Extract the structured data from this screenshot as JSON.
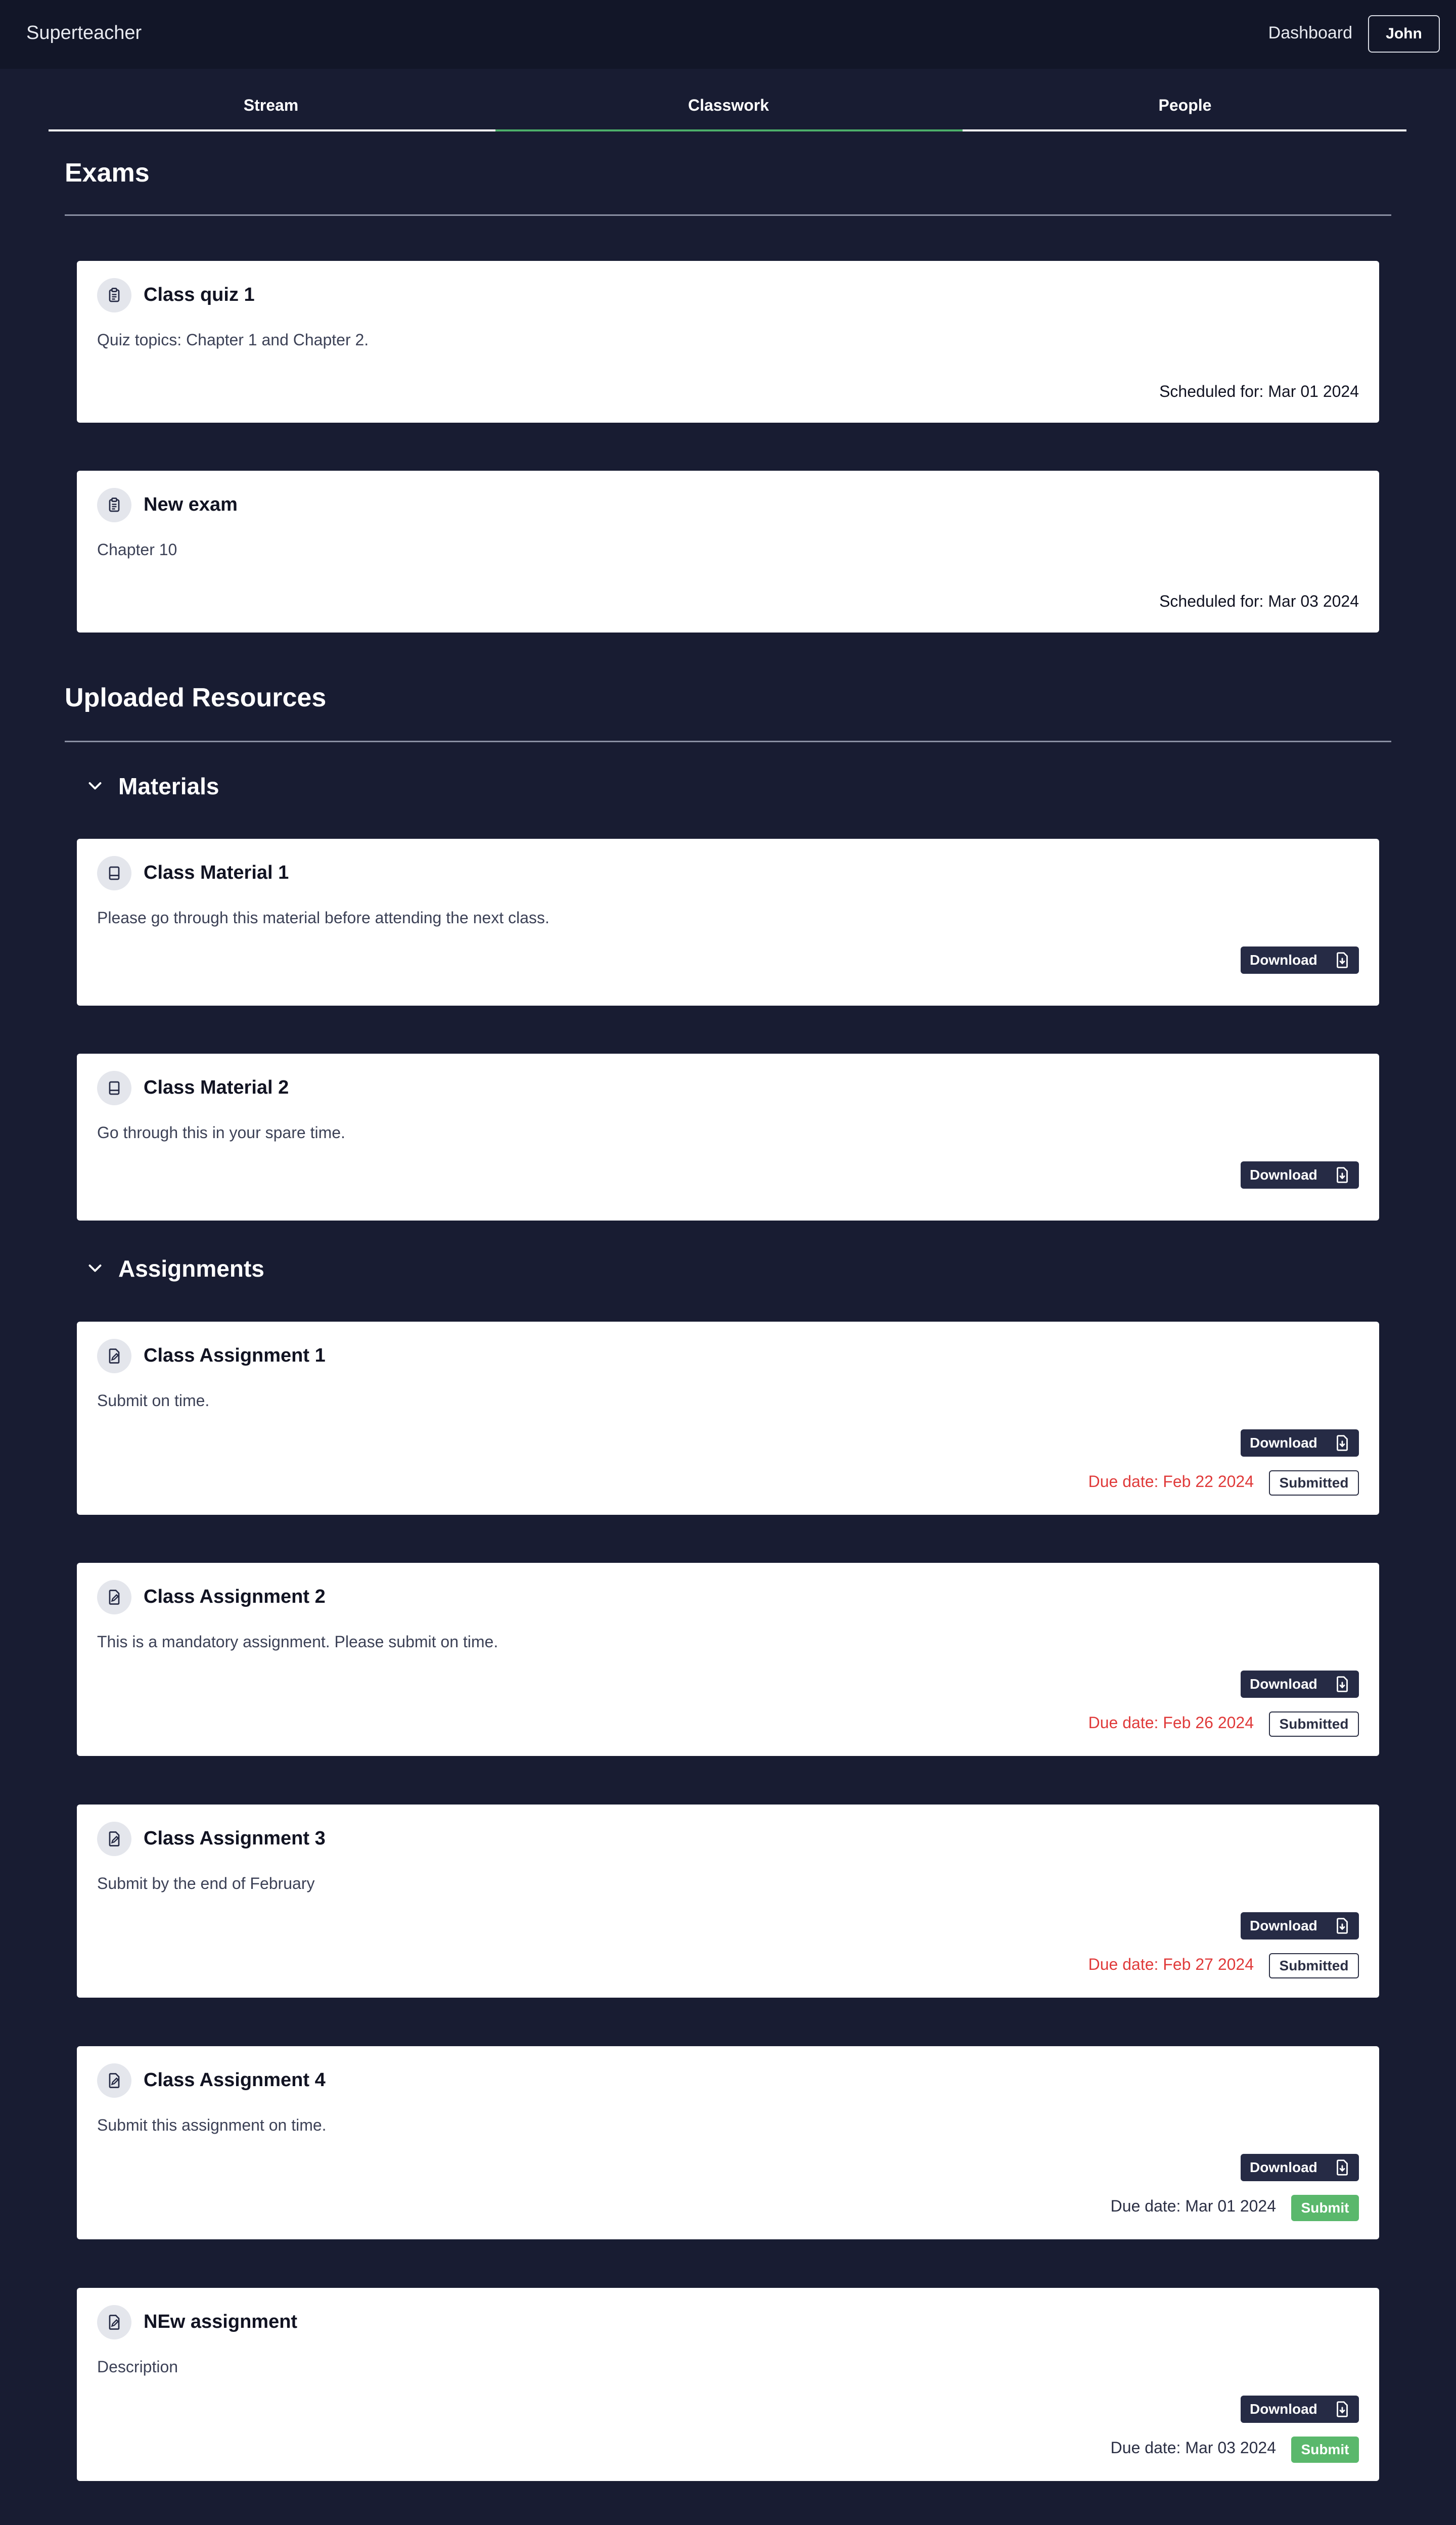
{
  "header": {
    "brand": "Superteacher",
    "dashboard_label": "Dashboard",
    "user_label": "John"
  },
  "tabs": [
    {
      "label": "Stream",
      "active": false
    },
    {
      "label": "Classwork",
      "active": true
    },
    {
      "label": "People",
      "active": false
    }
  ],
  "colors": {
    "background": "#181c32",
    "accent": "#4caf6a",
    "overdue": "#e03a3a",
    "submit": "#5ab86c"
  },
  "exams": {
    "title": "Exams",
    "items": [
      {
        "title": "Class quiz 1",
        "description": "Quiz topics: Chapter 1 and Chapter 2.",
        "scheduled": "Scheduled for: Mar 01 2024",
        "icon": "clipboard-icon"
      },
      {
        "title": "New exam",
        "description": "Chapter 10",
        "scheduled": "Scheduled for: Mar 03 2024",
        "icon": "clipboard-icon"
      }
    ]
  },
  "resources": {
    "title": "Uploaded Resources",
    "materials": {
      "label": "Materials",
      "items": [
        {
          "title": "Class Material 1",
          "description": "Please go through this material before attending the next class.",
          "download_label": "Download",
          "icon": "book-icon"
        },
        {
          "title": "Class Material 2",
          "description": "Go through this in your spare time.",
          "download_label": "Download",
          "icon": "book-icon"
        }
      ]
    },
    "assignments": {
      "label": "Assignments",
      "items": [
        {
          "title": "Class Assignment 1",
          "description": "Submit on time.",
          "download_label": "Download",
          "due": "Due date: Feb 22 2024",
          "overdue": true,
          "status": "Submitted",
          "icon": "file-edit-icon"
        },
        {
          "title": "Class Assignment 2",
          "description": "This is a mandatory assignment. Please submit on time.",
          "download_label": "Download",
          "due": "Due date: Feb 26 2024",
          "overdue": true,
          "status": "Submitted",
          "icon": "file-edit-icon"
        },
        {
          "title": "Class Assignment 3",
          "description": "Submit by the end of February",
          "download_label": "Download",
          "due": "Due date: Feb 27 2024",
          "overdue": true,
          "status": "Submitted",
          "icon": "file-edit-icon"
        },
        {
          "title": "Class Assignment 4",
          "description": "Submit this assignment on time.",
          "download_label": "Download",
          "due": "Due date: Mar 01 2024",
          "overdue": false,
          "status": "Submit",
          "icon": "file-edit-icon"
        },
        {
          "title": "NEw assignment",
          "description": "Description",
          "download_label": "Download",
          "due": "Due date: Mar 03 2024",
          "overdue": false,
          "status": "Submit",
          "icon": "file-edit-icon"
        }
      ]
    }
  }
}
